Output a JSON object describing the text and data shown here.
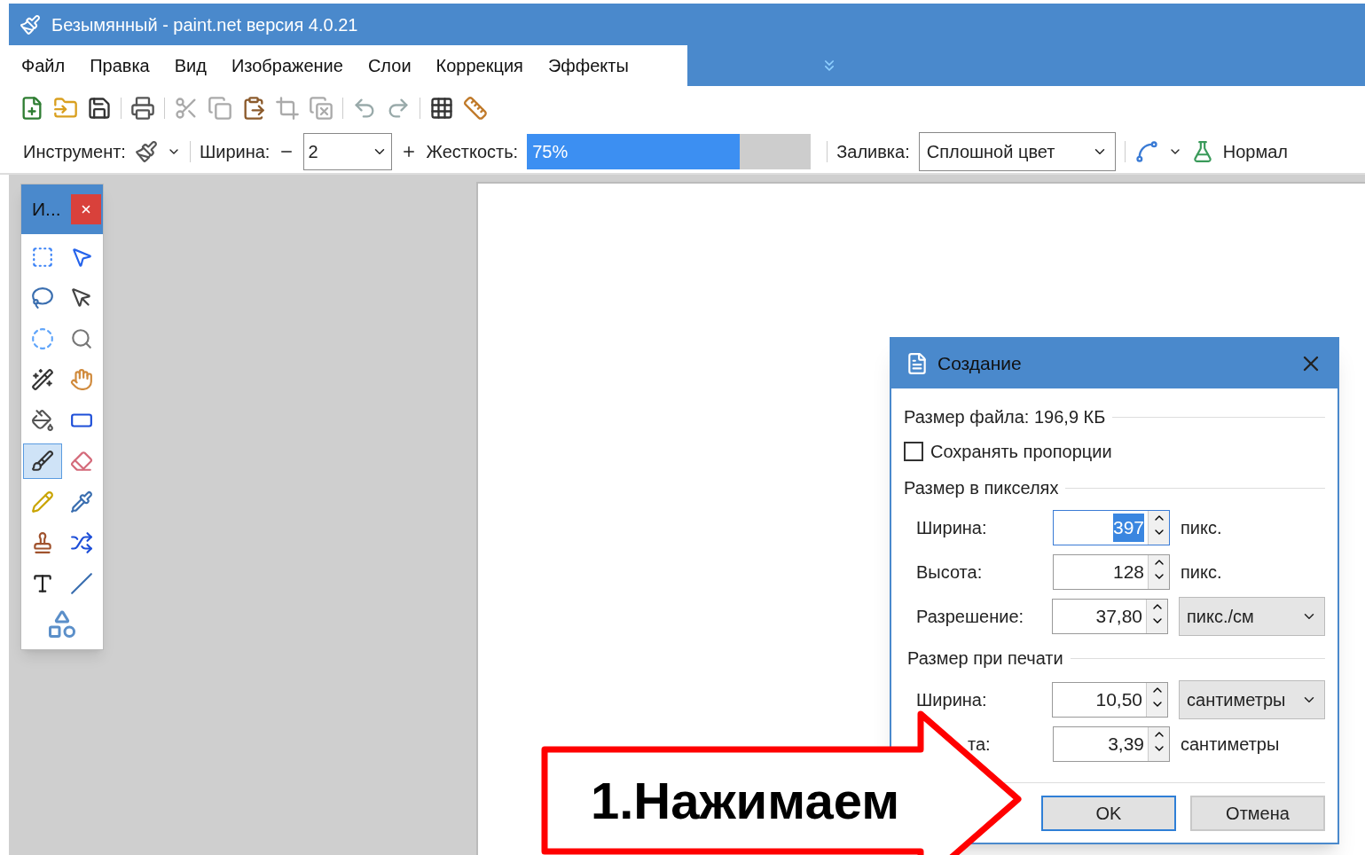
{
  "window": {
    "title": "Безымянный - paint.net версия 4.0.21"
  },
  "menu": [
    "Файл",
    "Правка",
    "Вид",
    "Изображение",
    "Слои",
    "Коррекция",
    "Эффекты"
  ],
  "tool_options": {
    "tool_label": "Инструмент:",
    "width_label": "Ширина:",
    "width_value": "2",
    "hardness_label": "Жесткость:",
    "hardness_value": "75%",
    "hardness_level": {
      "level": 0.75
    },
    "fill_label": "Заливка:",
    "fill_value": "Сплошной цвет",
    "blend_mode": "Нормал"
  },
  "tools_panel": {
    "title": "И...",
    "tools": [
      {
        "selected": false
      },
      {
        "selected": false
      },
      {
        "selected": false
      },
      {
        "selected": false
      },
      {
        "selected": false
      },
      {
        "selected": false
      },
      {
        "selected": false
      },
      {
        "selected": false
      },
      {
        "selected": false
      },
      {
        "selected": false
      },
      {
        "selected": true
      },
      {
        "selected": false
      },
      {
        "selected": false
      },
      {
        "selected": false
      },
      {
        "selected": false
      },
      {
        "selected": false
      },
      {
        "selected": false
      },
      {
        "selected": false
      },
      {
        "selected": false
      }
    ]
  },
  "dialog": {
    "title": "Создание",
    "file_size": "Размер файла: 196,9 КБ",
    "keep_proportions": {
      "label": "Сохранять пропорции",
      "checked": false
    },
    "pixel_section": "Размер в пикселях",
    "pixel_rows": [
      {
        "label": "Ширина:",
        "value": "397",
        "focused": true,
        "unit": "пикс.",
        "kind": "text"
      },
      {
        "label": "Высота:",
        "value": "128",
        "focused": false,
        "unit": "пикс.",
        "kind": "text"
      },
      {
        "label": "Разрешение:",
        "value": "37,80",
        "focused": false,
        "unit": "пикс./см",
        "kind": "dropdown"
      }
    ],
    "print_section": "Размер при печати",
    "print_rows": [
      {
        "label": "Ширина:",
        "value": "10,50",
        "focused": false,
        "unit": "сантиметры",
        "kind": "dropdown"
      },
      {
        "label": "та:",
        "value": "3,39",
        "focused": false,
        "unit": "сантиметры",
        "kind": "text"
      }
    ],
    "buttons": [
      {
        "label": "OK",
        "default": true
      },
      {
        "label": "Отмена",
        "default": false
      }
    ]
  },
  "annotation": {
    "text": "1.Нажимаем"
  }
}
